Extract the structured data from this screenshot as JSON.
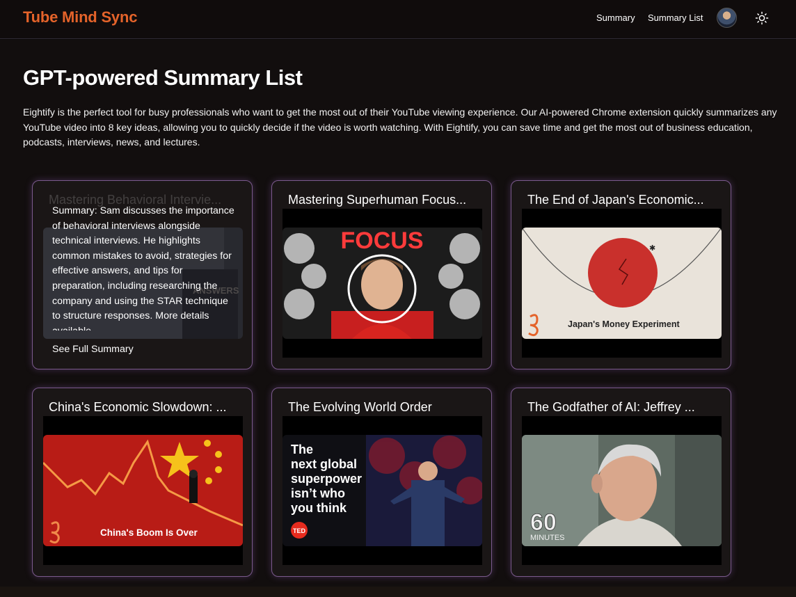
{
  "app": {
    "brand": "Tube Mind Sync"
  },
  "nav": {
    "summary": "Summary",
    "summary_list": "Summary List",
    "theme_toggle_icon": "sun-icon",
    "avatar_icon": "user-avatar"
  },
  "page": {
    "title": "GPT-powered Summary List",
    "description": "Eightify is the perfect tool for busy professionals who want to get the most out of their YouTube viewing experience. Our AI-powered Chrome extension quickly summarizes any YouTube video into 8 key ideas, allowing you to quickly decide if the video is worth watching. With Eightify, you can save time and get the most out of business education, podcasts, interviews, news, and lectures."
  },
  "colors": {
    "brand": "#e4632a",
    "card_border": "#7b5a8d",
    "background": "#120e0e"
  },
  "cards": [
    {
      "title": "Mastering Behavioral Intervie...",
      "hovered": true,
      "summary": "Summary: Sam discusses the importance of behavioral interviews alongside technical interviews. He highlights common mistakes to avoid, strategies for effective answers, and tips for preparation, including researching the company and using the STAR technique to structure responses. More details available...",
      "link": "See Full Summary",
      "thumb_text": "ANSWERS"
    },
    {
      "title": "Mastering Superhuman Focus...",
      "thumb_text": "FOCUS"
    },
    {
      "title": "The End of Japan's Economic...",
      "thumb_text": "Japan's Money Experiment"
    },
    {
      "title": "China's Economic Slowdown: ...",
      "thumb_text": "China's Boom Is Over"
    },
    {
      "title": "The Evolving World Order",
      "thumb_text": [
        "The",
        "next global",
        "superpower",
        "isn’t who",
        "you think"
      ],
      "badge": "TED"
    },
    {
      "title": "The Godfather of AI: Jeffrey ...",
      "thumb_text": [
        "60",
        "MINUTES"
      ]
    }
  ]
}
